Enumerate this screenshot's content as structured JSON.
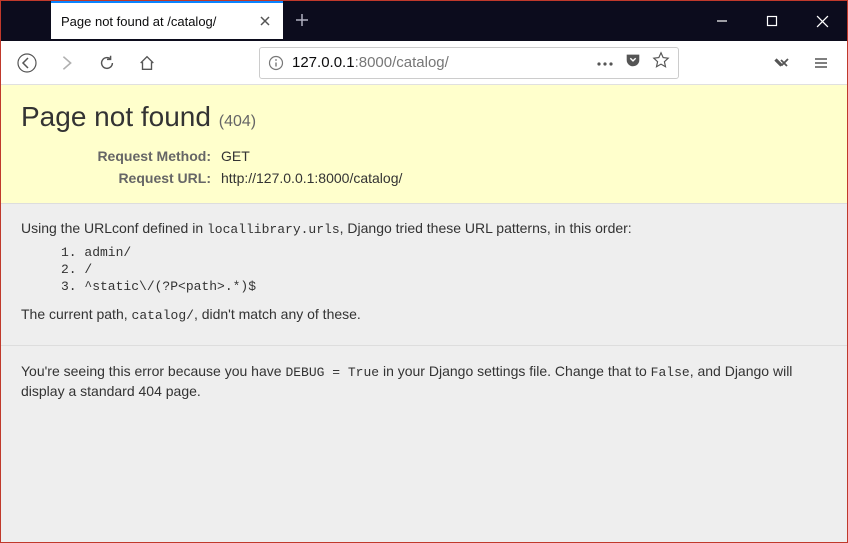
{
  "browser": {
    "tab_title": "Page not found at /catalog/",
    "url_display_host": "127.0.0.1",
    "url_display_port": ":8000",
    "url_display_path": "/catalog/"
  },
  "error": {
    "title": "Page not found",
    "code": "(404)",
    "request_method_label": "Request Method:",
    "request_method_value": "GET",
    "request_url_label": "Request URL:",
    "request_url_value": "http://127.0.0.1:8000/catalog/",
    "intro_prefix": "Using the URLconf defined in ",
    "intro_module": "locallibrary.urls",
    "intro_suffix": ", Django tried these URL patterns, in this order:",
    "patterns": [
      "admin/",
      "/",
      "^static\\/(?P<path>.*)$"
    ],
    "nomatch_prefix": "The current path, ",
    "nomatch_path": "catalog/",
    "nomatch_suffix": ", didn't match any of these.",
    "debug_prefix": "You're seeing this error because you have ",
    "debug_code": "DEBUG = True",
    "debug_mid": " in your Django settings file. Change that to ",
    "debug_false": "False",
    "debug_suffix": ", and Django will display a standard 404 page."
  }
}
